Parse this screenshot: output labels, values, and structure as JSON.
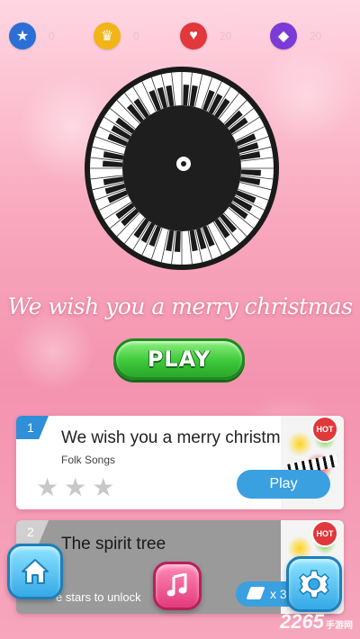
{
  "stats": {
    "stars": "0",
    "crowns": "0",
    "hearts": "20",
    "gems": "20"
  },
  "now_playing": {
    "title": "We wish you a merry christmas",
    "play_label": "PLAY"
  },
  "songs": [
    {
      "index": "1",
      "title": "We wish you a merry christmas",
      "genre": "Folk Songs",
      "badge": "HOT",
      "action_label": "Play",
      "stars": 0
    },
    {
      "index": "2",
      "title": "The spirit tree",
      "badge": "HOT",
      "unlock_text": "e stars to unlock",
      "unlock_cost": "x 3"
    }
  ],
  "icons": {
    "stat_star": "star-icon",
    "stat_crown": "crown-icon",
    "stat_heart": "heart-icon",
    "stat_gem": "gem-icon",
    "nav_home": "home-icon",
    "nav_music": "music-note-icon",
    "nav_settings": "gear-icon"
  },
  "colors": {
    "accent_green": "#3dc93a",
    "accent_blue": "#3aa0e0",
    "hot_red": "#e0383b",
    "background_pink": "#f493b0"
  },
  "watermark": {
    "text": "2265",
    "suffix": "手游网"
  }
}
